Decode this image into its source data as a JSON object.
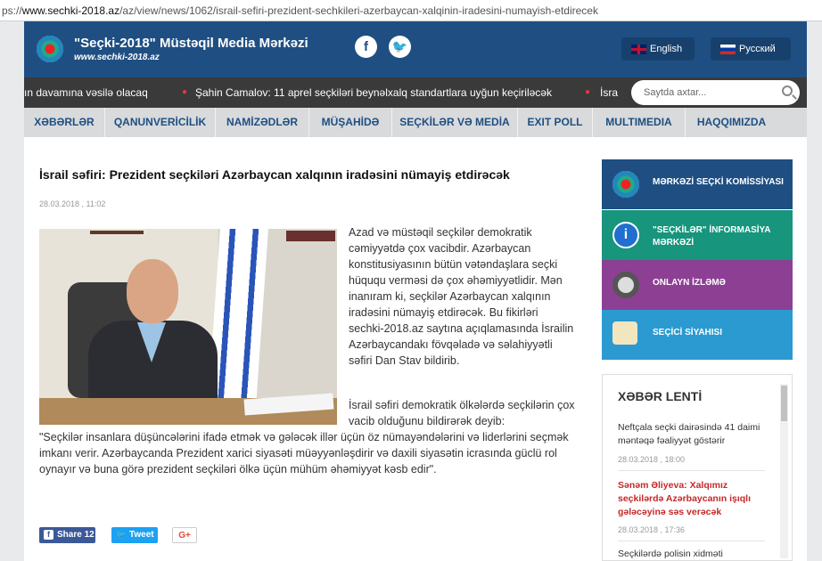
{
  "browser": {
    "url_prefix": "ps://",
    "url_host": "www.sechki-2018.az",
    "url_path": "/az/view/news/1062/israil-sefiri-prezident-sechkileri-azerbaycan-xalqinin-iradesini-numayish-etdirecek"
  },
  "header": {
    "title": "\"Seçki-2018\" Müstəqil Media Mərkəzi",
    "subtitle": "www.sechki-2018.az",
    "lang_en": "English",
    "lang_ru": "Русский"
  },
  "ticker": {
    "items": [
      "ın davamına vəsilə olacaq",
      "Şahin Camalov: 11 aprel seçkiləri beynəlxalq standartlara uyğun keçiriləcək",
      "İsra"
    ]
  },
  "search": {
    "placeholder": "Saytda axtar..."
  },
  "nav": [
    "XƏBƏRLƏR",
    "QANUNVERİCİLİK",
    "NAMİZƏDLƏR",
    "MÜŞAHİDƏ",
    "SEÇKİLƏR VƏ MEDİA",
    "EXIT POLL",
    "MULTIMEDIA",
    "HAQQIMIZDA"
  ],
  "article": {
    "title": "İsrail səfiri: Prezident seçkiləri Azərbaycan xalqının iradəsini nümayiş etdirəcək",
    "date": "28.03.2018 , 11:02",
    "p1": "Azad və müstəqil seçkilər demokratik cəmiyyətdə çox vacibdir. Azərbaycan konstitusiyasının bütün vətəndaşlara seçki hüququ verməsi də çox əhəmiyyətlidir. Mən inanıram ki, seçkilər Azərbaycan xalqının iradəsini nümayiş etdirəcək. Bu fikirləri sechki-2018.az saytına açıqlamasında İsrailin Azərbaycandakı fövqəladə və səlahiyyətli səfiri Dan Stav bildirib.",
    "p2": "İsrail səfiri demokratik ölkələrdə seçkilərin çox vacib olduğunu bildirərək deyib:",
    "p3": "\"Seçkilər insanlara düşüncələrini ifadə etmək və gələcək illər üçün öz nümayəndələrini və liderlərini seçmək imkanı verir. Azərbaycanda Prezident xarici siyasəti müəyyənləşdirir və daxili siyasətin icrasında güclü rol oynayır və buna görə prezident seçkiləri ölkə üçün mühüm əhəmiyyət kəsb edir\"."
  },
  "share": {
    "fb_label": "Share 12",
    "tw_label": "Tweet",
    "gp_label": "G+"
  },
  "sidebar": [
    "MƏRKƏZİ SEÇKİ KOMİSSİYASI",
    "\"SEÇKİLƏR\" İNFORMASİYA MƏRKƏZİ",
    "ONLAYN İZLƏMƏ",
    "SEÇİCİ SİYAHISI"
  ],
  "feed": {
    "title": "XƏBƏR LENTİ",
    "items": [
      {
        "text": "Neftçala seçki dairəsində 41 daimi məntəqə fəaliyyət göstərir",
        "date": "28.03.2018 , 18:00"
      },
      {
        "text": "Sənəm Əliyeva: Xalqımız seçkilərdə Azərbaycanın işıqlı gələcəyinə səs verəcək",
        "date": "28.03.2018 , 17:36"
      },
      {
        "text": "Seçkilərdə polisin xidməti",
        "date": ""
      }
    ]
  }
}
